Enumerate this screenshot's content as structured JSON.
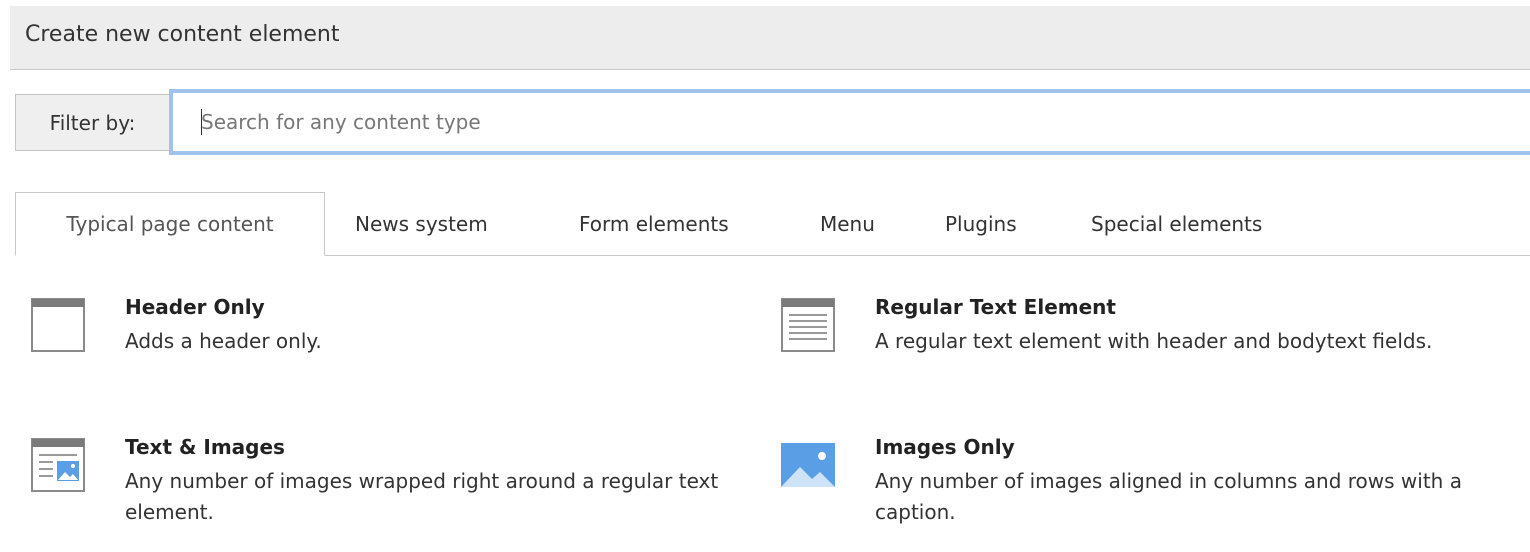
{
  "window": {
    "title": "Create new content element"
  },
  "filter": {
    "label": "Filter by:",
    "placeholder": "Search for any content type",
    "value": ""
  },
  "tabs": [
    {
      "label": "Typical page content",
      "active": true
    },
    {
      "label": "News system",
      "active": false
    },
    {
      "label": "Form elements",
      "active": false
    },
    {
      "label": "Menu",
      "active": false
    },
    {
      "label": "Plugins",
      "active": false
    },
    {
      "label": "Special elements",
      "active": false
    }
  ],
  "elements": [
    {
      "icon": "header-only-icon",
      "title": "Header Only",
      "description": "Adds a header only."
    },
    {
      "icon": "regular-text-icon",
      "title": "Regular Text Element",
      "description": "A regular text element with header and bodytext fields."
    },
    {
      "icon": "text-images-icon",
      "title": "Text & Images",
      "description": "Any number of images wrapped right around a regular text element."
    },
    {
      "icon": "images-only-icon",
      "title": "Images Only",
      "description": "Any number of images aligned in columns and rows with a caption."
    }
  ],
  "colors": {
    "focus_border": "#9fc3ea",
    "image_blue": "#5a9ee6",
    "icon_gray": "#8a8a8a"
  }
}
